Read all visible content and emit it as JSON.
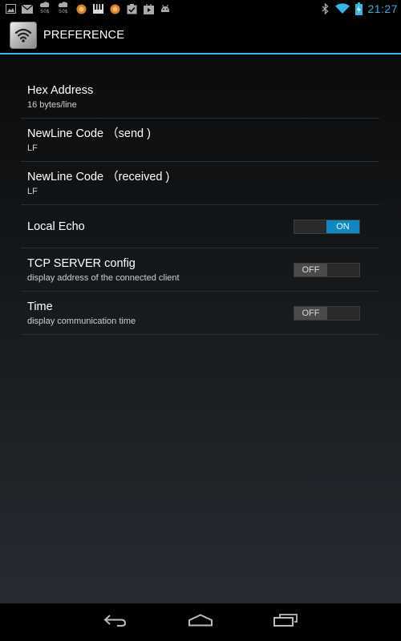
{
  "status_bar": {
    "clock": "21:27",
    "weather_temp_1": "50$",
    "weather_temp_2": "50$",
    "notification_icons": [
      "gallery-icon",
      "email-icon",
      "weather-icon",
      "weather-icon",
      "orange-circle-icon",
      "piano-icon",
      "orange-circle-icon",
      "checklist-icon",
      "play-store-icon",
      "android-icon"
    ],
    "system_icons": [
      "bluetooth-icon",
      "wifi-icon",
      "battery-charging-icon"
    ],
    "clock_color": "#33b5e5"
  },
  "action_bar": {
    "title": "PREFERENCE",
    "icon": "wifi-app-icon",
    "divider_color": "#33b5e5"
  },
  "preferences": [
    {
      "title": "Hex Address",
      "summary": "16 bytes/line"
    },
    {
      "title": "NewLine Code （send )",
      "summary": "LF"
    },
    {
      "title": "NewLine Code （received )",
      "summary": "LF"
    },
    {
      "title": "Local Echo",
      "summary": "",
      "toggle": {
        "state": "on",
        "label": "ON"
      }
    },
    {
      "title": "TCP SERVER config",
      "summary": "display address of the connected client",
      "toggle": {
        "state": "off",
        "label": "OFF"
      }
    },
    {
      "title": "Time",
      "summary": "display communication time",
      "toggle": {
        "state": "off",
        "label": "OFF"
      }
    }
  ],
  "nav_bar": {
    "buttons": [
      "back-icon",
      "home-icon",
      "recent-apps-icon"
    ]
  },
  "colors": {
    "accent": "#33b5e5",
    "switch_on": "#0e88c0",
    "switch_off": "#4a4a4a"
  }
}
